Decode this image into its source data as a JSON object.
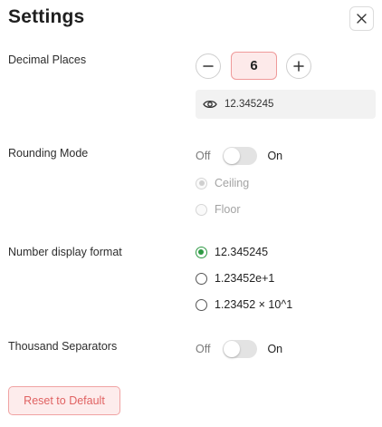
{
  "header": {
    "title": "Settings",
    "close_icon": "close-icon"
  },
  "decimal_places": {
    "label": "Decimal Places",
    "value": "6",
    "decrement_icon": "minus-icon",
    "increment_icon": "plus-icon",
    "preview_icon": "eye-icon",
    "preview_value": "12.345245"
  },
  "rounding_mode": {
    "label": "Rounding Mode",
    "toggle_off_label": "Off",
    "toggle_on_label": "On",
    "enabled": false,
    "options": [
      {
        "label": "Ceiling",
        "selected": true,
        "disabled": true
      },
      {
        "label": "Floor",
        "selected": false,
        "disabled": true
      }
    ]
  },
  "number_format": {
    "label": "Number display format",
    "options": [
      {
        "label": "12.345245",
        "selected": true
      },
      {
        "label": "1.23452e+1",
        "selected": false
      },
      {
        "label": "1.23452 × 10^1",
        "selected": false
      }
    ]
  },
  "thousand_separators": {
    "label": "Thousand Separators",
    "toggle_off_label": "Off",
    "toggle_on_label": "On",
    "enabled": false
  },
  "footer": {
    "reset_label": "Reset to Default"
  },
  "colors": {
    "accent_green": "#2e9a44",
    "danger_text": "#e06262",
    "danger_bg": "#fdecec",
    "danger_border": "#f0a3a3"
  }
}
